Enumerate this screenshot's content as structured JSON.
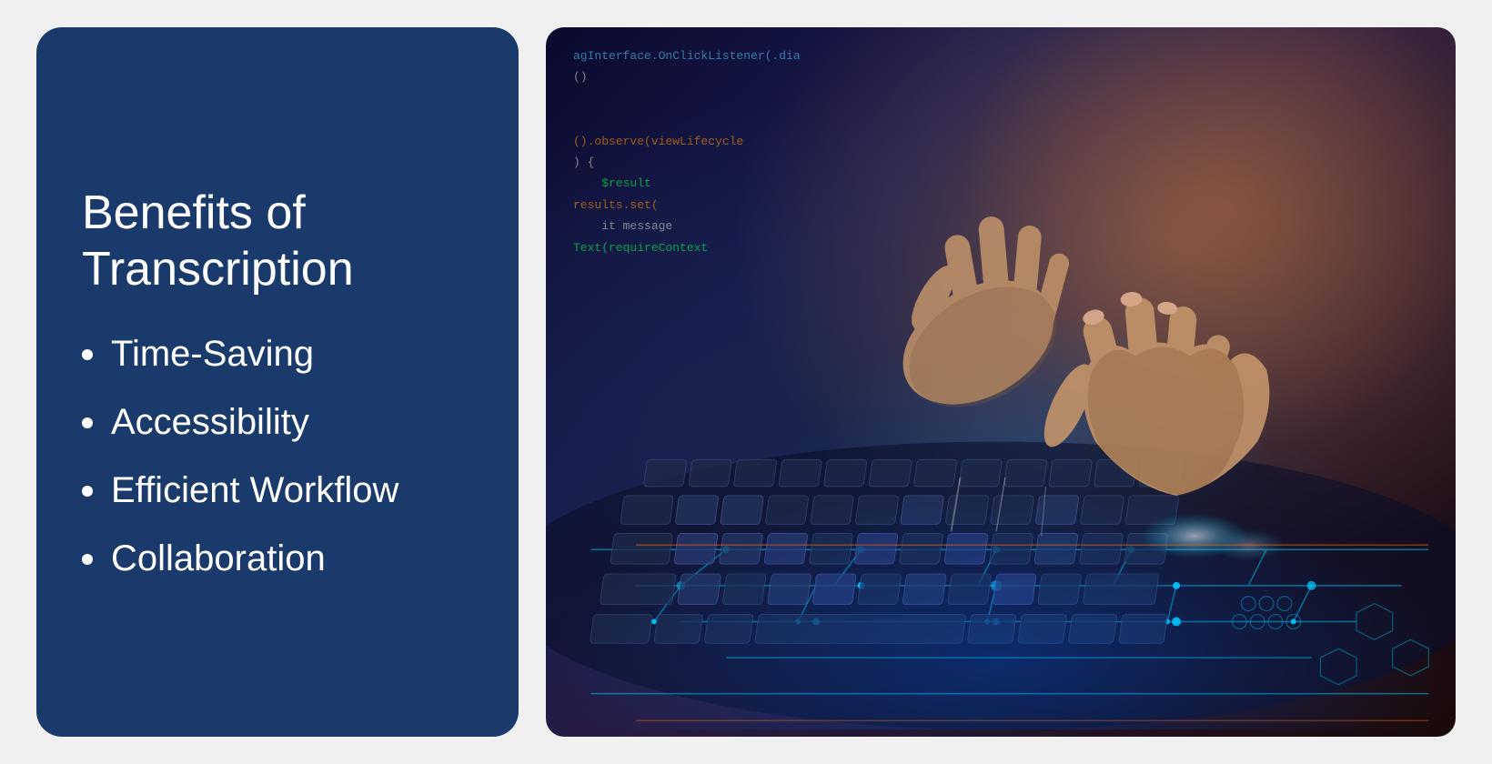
{
  "left_panel": {
    "background_color": "#1a3a6b",
    "title_line1": "Benefits of",
    "title_line2": "Transcription",
    "bullet_items": [
      {
        "id": "time-saving",
        "label": "Time-Saving"
      },
      {
        "id": "accessibility",
        "label": "Accessibility"
      },
      {
        "id": "efficient-workflow",
        "label": "Efficient Workflow"
      },
      {
        "id": "collaboration",
        "label": "Collaboration"
      }
    ]
  },
  "right_panel": {
    "alt_text": "Hands typing on a keyboard with code and digital circuit overlay",
    "code_lines": [
      {
        "text": "agInterface.OnClickListener(.dia",
        "style": "green"
      },
      {
        "text": "()",
        "style": "white"
      },
      {
        "text": "",
        "style": "white"
      },
      {
        "text": "().observe(viewLifecycle",
        "style": "orange"
      },
      {
        "text": "    $result",
        "style": "green"
      },
      {
        "text": "results.set(",
        "style": "orange"
      },
      {
        "text": "Text(requireContext",
        "style": "green"
      }
    ]
  }
}
